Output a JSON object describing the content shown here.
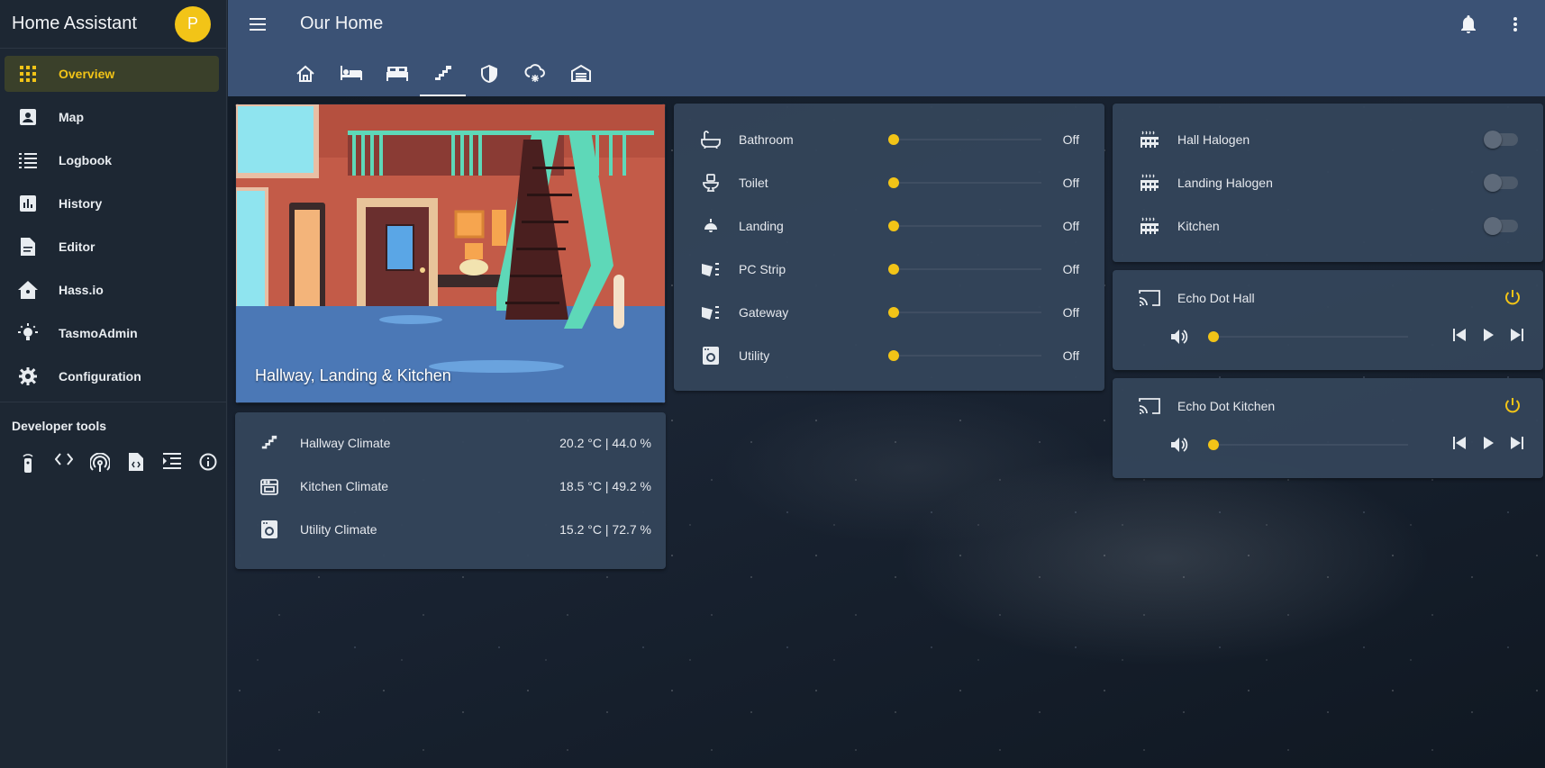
{
  "sidebar": {
    "title": "Home Assistant",
    "avatar_initial": "P",
    "items": [
      {
        "label": "Overview",
        "icon": "apps-grid-icon",
        "active": true
      },
      {
        "label": "Map",
        "icon": "account-box-icon"
      },
      {
        "label": "Logbook",
        "icon": "format-list-icon"
      },
      {
        "label": "History",
        "icon": "chart-box-icon"
      },
      {
        "label": "Editor",
        "icon": "file-document-icon"
      },
      {
        "label": "Hass.io",
        "icon": "home-assistant-icon"
      },
      {
        "label": "TasmoAdmin",
        "icon": "lightbulb-icon"
      },
      {
        "label": "Configuration",
        "icon": "gear-icon"
      }
    ],
    "dev_tools_title": "Developer tools",
    "dev_tools": [
      "remote-icon",
      "code-icon",
      "antenna-icon",
      "file-code-icon",
      "template-icon",
      "info-icon"
    ]
  },
  "header": {
    "title": "Our Home",
    "tabs": [
      "home-icon",
      "bed-single-icon",
      "bed-double-icon",
      "stairs-icon",
      "shield-icon",
      "weather-snowy-icon",
      "garage-icon"
    ],
    "active_tab_index": 3
  },
  "picture_card": {
    "caption": "Hallway, Landing & Kitchen"
  },
  "climate": [
    {
      "name": "Hallway Climate",
      "value": "20.2 °C | 44.0 %",
      "icon": "stairs-icon"
    },
    {
      "name": "Kitchen Climate",
      "value": "18.5 °C | 49.2 %",
      "icon": "stove-icon"
    },
    {
      "name": "Utility Climate",
      "value": "15.2 °C | 72.7 %",
      "icon": "washing-machine-icon"
    }
  ],
  "lights": [
    {
      "name": "Bathroom",
      "state": "Off",
      "icon": "bathtub-icon",
      "level": 0
    },
    {
      "name": "Toilet",
      "state": "Off",
      "icon": "toilet-icon",
      "level": 0
    },
    {
      "name": "Landing",
      "state": "Off",
      "icon": "ceiling-light-icon",
      "level": 0
    },
    {
      "name": "PC Strip",
      "state": "Off",
      "icon": "led-strip-icon",
      "level": 0
    },
    {
      "name": "Gateway",
      "state": "Off",
      "icon": "led-strip-icon",
      "level": 0
    },
    {
      "name": "Utility",
      "state": "Off",
      "icon": "washing-machine-icon",
      "level": 0
    }
  ],
  "switches": [
    {
      "name": "Hall Halogen",
      "on": false,
      "icon": "radiator-icon"
    },
    {
      "name": "Landing Halogen",
      "on": false,
      "icon": "radiator-icon"
    },
    {
      "name": "Kitchen",
      "on": false,
      "icon": "radiator-icon"
    }
  ],
  "media": [
    {
      "name": "Echo Dot Hall",
      "volume": 0
    },
    {
      "name": "Echo Dot Kitchen",
      "volume": 0
    }
  ],
  "colors": {
    "accent": "#f2c417",
    "header": "#3b5275",
    "sidebar": "#1d2733",
    "card": "#34455a"
  }
}
